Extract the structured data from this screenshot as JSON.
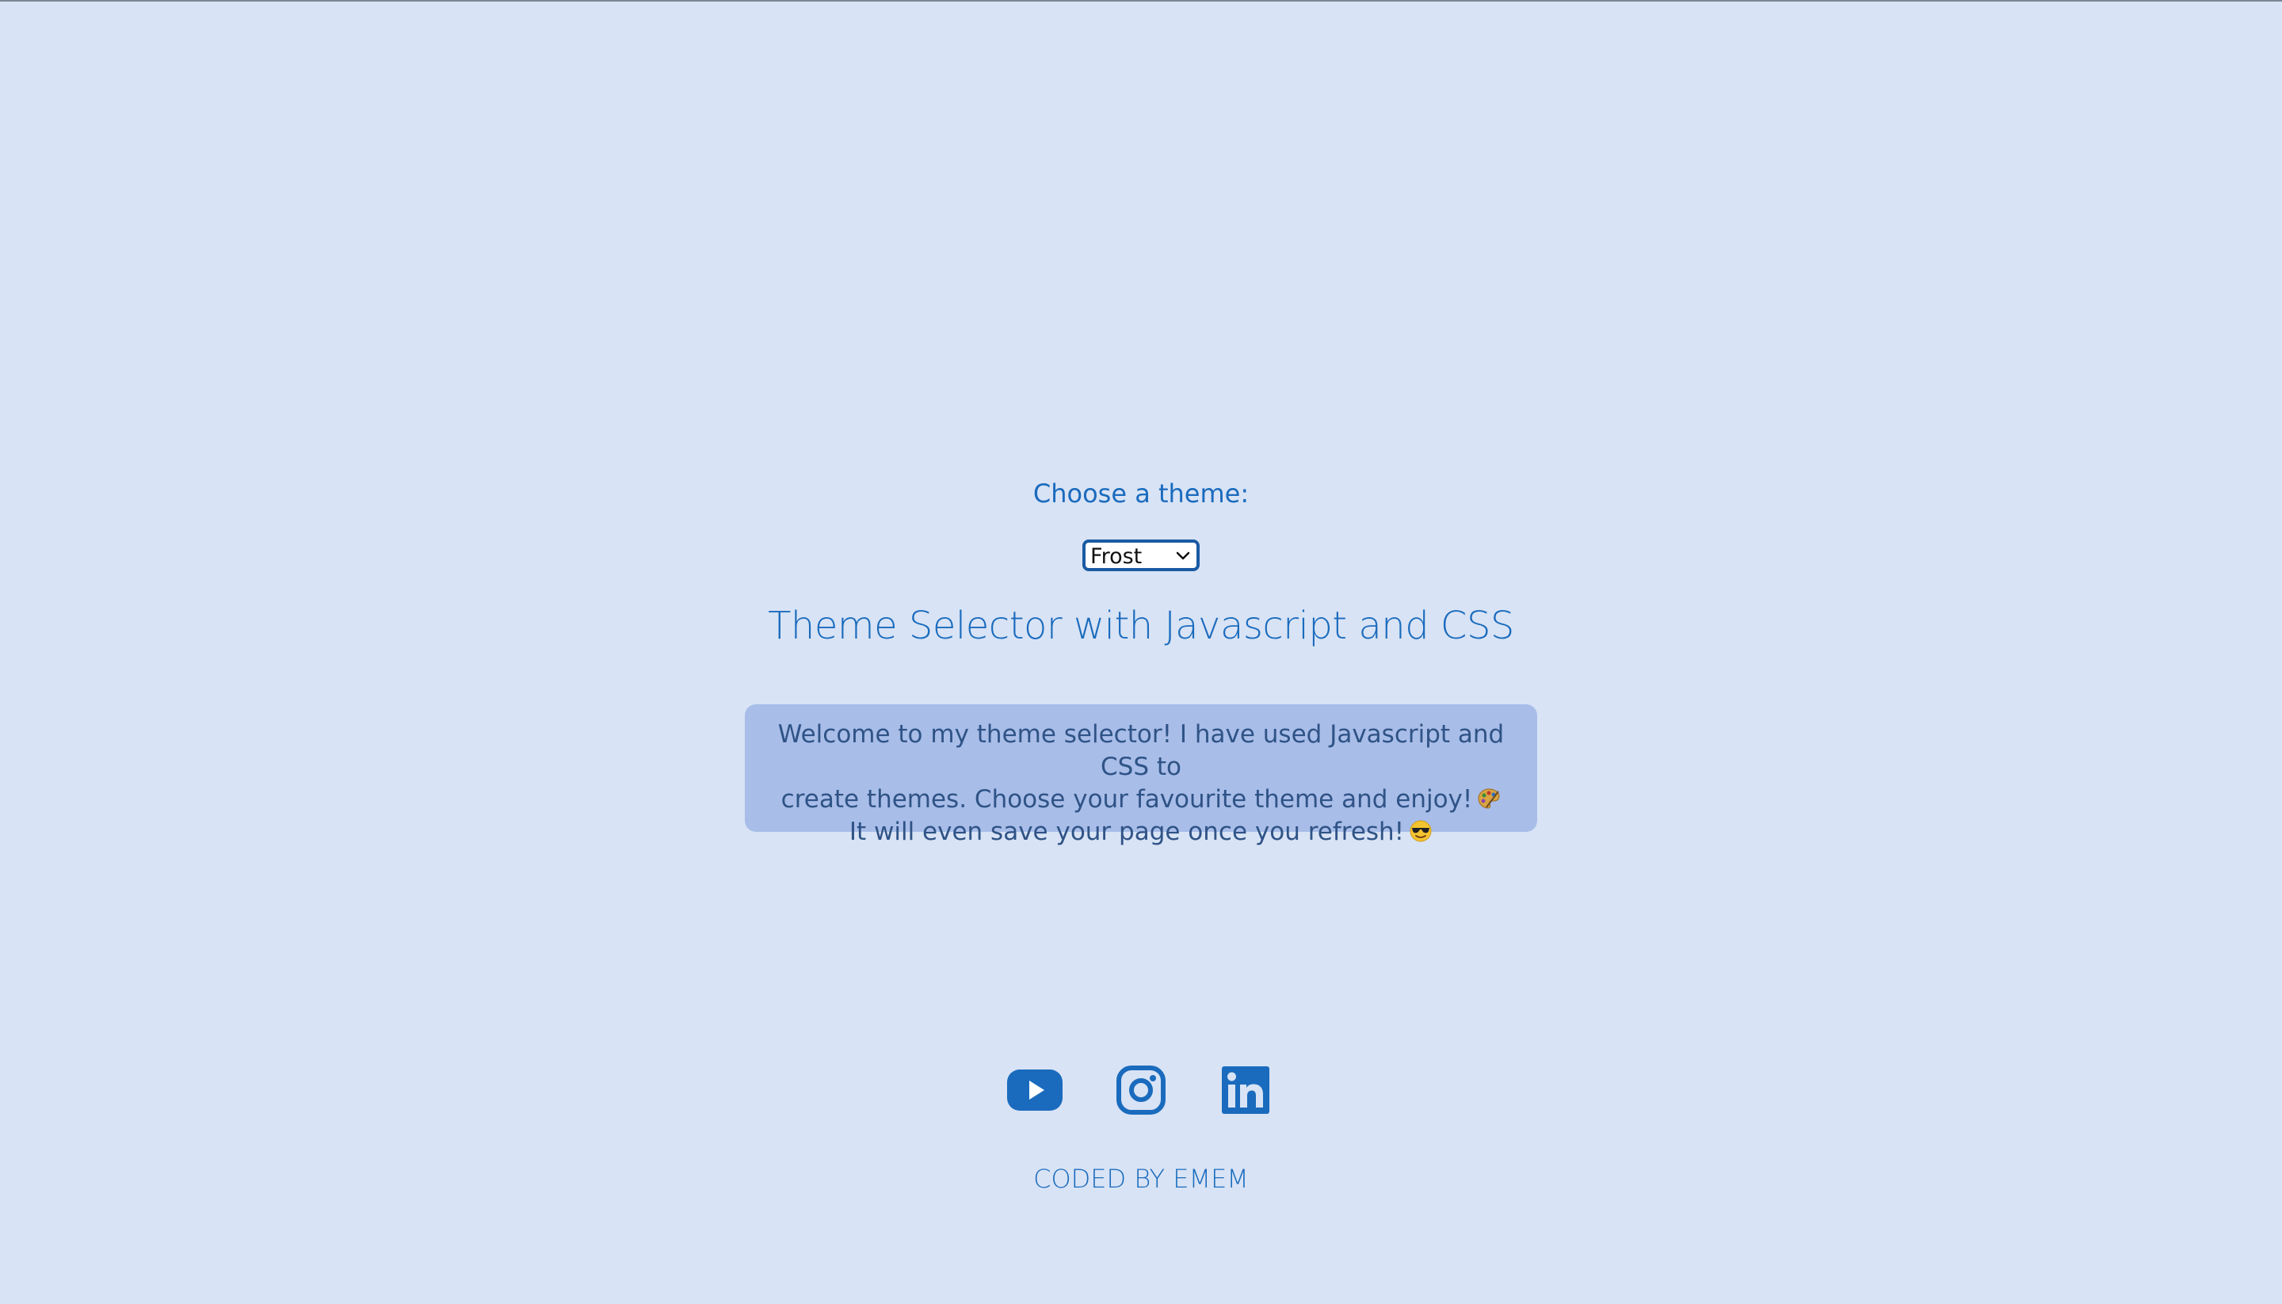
{
  "theme_picker": {
    "label": "Choose a theme:",
    "selected": "Frost"
  },
  "heading": "Theme Selector with Javascript and CSS",
  "intro": {
    "line1": "Welcome to my theme selector! I have used Javascript and CSS to",
    "line2": "create themes. Choose your favourite theme and enjoy!",
    "line3": "It will even save your page once you refresh!"
  },
  "icons": {
    "palette_emoji": "palette-emoji",
    "sunglasses_emoji": "sunglasses-emoji",
    "youtube": "youtube-icon",
    "instagram": "instagram-icon",
    "linkedin": "linkedin-icon"
  },
  "footer": "CODED BY EMEM",
  "colors": {
    "background": "#d8e3f5",
    "accent": "#1a6bbd",
    "box": "#a8bde8",
    "box_text": "#2f5386"
  }
}
